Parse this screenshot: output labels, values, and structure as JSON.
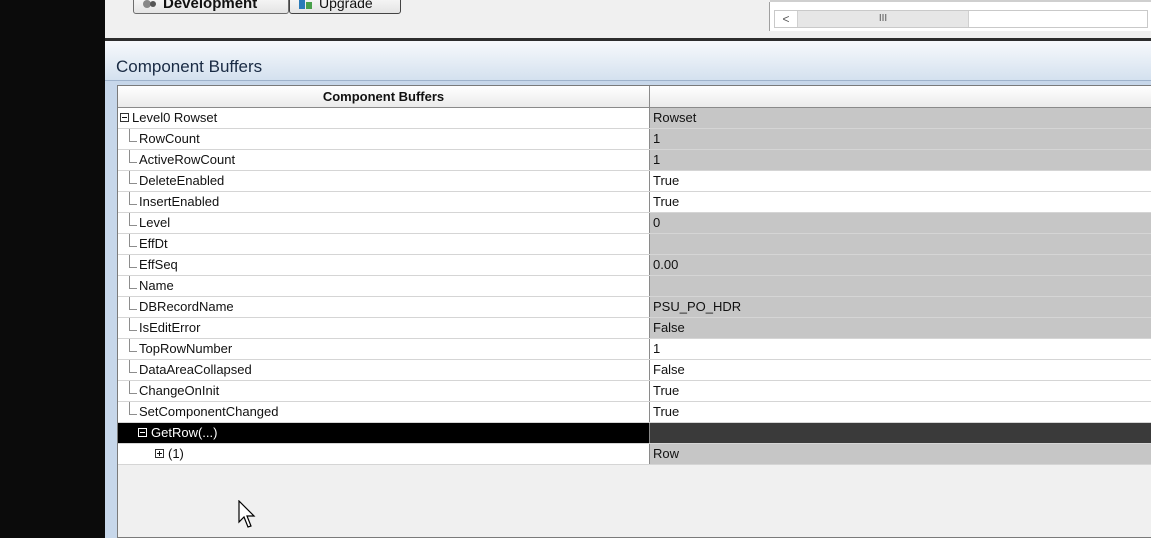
{
  "toolbar": {
    "tabs": [
      {
        "label": "Development"
      },
      {
        "label": "Upgrade"
      }
    ]
  },
  "scrollbar": {
    "left_arrow": "<",
    "thumb_grip": "III"
  },
  "panel": {
    "title": "Component Buffers"
  },
  "grid": {
    "header_col1": "Component Buffers",
    "header_col2": "",
    "rows": [
      {
        "name": "Level0 Rowset",
        "value": "Rowset"
      },
      {
        "name": "RowCount",
        "value": "1"
      },
      {
        "name": "ActiveRowCount",
        "value": "1"
      },
      {
        "name": "DeleteEnabled",
        "value": "True"
      },
      {
        "name": "InsertEnabled",
        "value": "True"
      },
      {
        "name": "Level",
        "value": "0"
      },
      {
        "name": "EffDt",
        "value": ""
      },
      {
        "name": "EffSeq",
        "value": "0.00"
      },
      {
        "name": "Name",
        "value": ""
      },
      {
        "name": "DBRecordName",
        "value": "PSU_PO_HDR"
      },
      {
        "name": "IsEditError",
        "value": "False"
      },
      {
        "name": "TopRowNumber",
        "value": "1"
      },
      {
        "name": "DataAreaCollapsed",
        "value": "False"
      },
      {
        "name": "ChangeOnInit",
        "value": "True"
      },
      {
        "name": "SetComponentChanged",
        "value": "True"
      },
      {
        "name": "GetRow(...)",
        "value": ""
      },
      {
        "name": "(1)",
        "value": "Row"
      }
    ]
  },
  "colors": {
    "panel_bg": "#c7d7ea",
    "selected_row": "#000000",
    "readonly_cell": "#c6c6c6"
  }
}
